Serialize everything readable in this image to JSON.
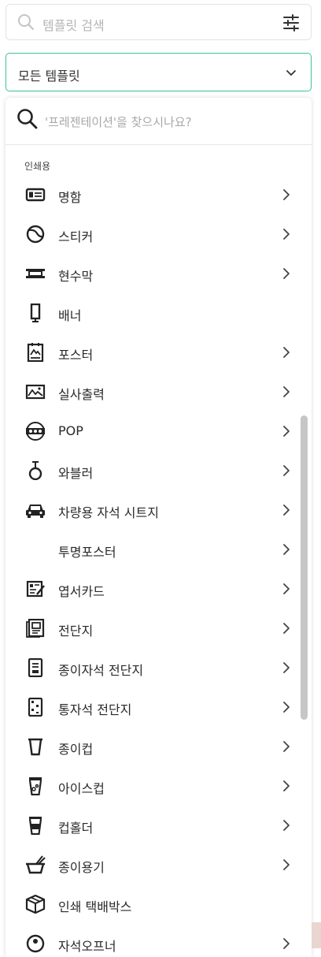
{
  "search": {
    "placeholder": "템플릿 검색"
  },
  "category_select": {
    "value": "모든 템플릿"
  },
  "dropdown": {
    "search_placeholder": "'프레젠테이션'을 찾으시나요?",
    "section_title": "인쇄용",
    "items": [
      {
        "label": "명함",
        "icon": "business-card-icon",
        "has_arrow": true
      },
      {
        "label": "스티커",
        "icon": "sticker-icon",
        "has_arrow": true
      },
      {
        "label": "현수막",
        "icon": "banner-frame-icon",
        "has_arrow": true
      },
      {
        "label": "배너",
        "icon": "standing-banner-icon",
        "has_arrow": false
      },
      {
        "label": "포스터",
        "icon": "poster-icon",
        "has_arrow": true
      },
      {
        "label": "실사출력",
        "icon": "photo-print-icon",
        "has_arrow": true
      },
      {
        "label": "POP",
        "icon": "pop-badge-icon",
        "has_arrow": true
      },
      {
        "label": "와블러",
        "icon": "wobbler-icon",
        "has_arrow": true
      },
      {
        "label": "차량용 자석 시트지",
        "icon": "car-icon",
        "has_arrow": true
      },
      {
        "label": "투명포스터",
        "icon": "",
        "has_arrow": true
      },
      {
        "label": "엽서카드",
        "icon": "postcard-icon",
        "has_arrow": true
      },
      {
        "label": "전단지",
        "icon": "flyer-icon",
        "has_arrow": true
      },
      {
        "label": "종이자석 전단지",
        "icon": "magnet-flyer-icon",
        "has_arrow": true
      },
      {
        "label": "통자석 전단지",
        "icon": "full-magnet-flyer-icon",
        "has_arrow": true
      },
      {
        "label": "종이컵",
        "icon": "paper-cup-icon",
        "has_arrow": true
      },
      {
        "label": "아이스컵",
        "icon": "ice-cup-icon",
        "has_arrow": true
      },
      {
        "label": "컵홀더",
        "icon": "cup-holder-icon",
        "has_arrow": true
      },
      {
        "label": "종이용기",
        "icon": "paper-bowl-icon",
        "has_arrow": true
      },
      {
        "label": "인쇄 택배박스",
        "icon": "box-icon",
        "has_arrow": false
      },
      {
        "label": "자석오프너",
        "icon": "opener-icon",
        "has_arrow": true
      }
    ]
  },
  "colors": {
    "accent": "#3cc294",
    "text": "#2a2a2a",
    "placeholder": "#b4b4b4"
  }
}
